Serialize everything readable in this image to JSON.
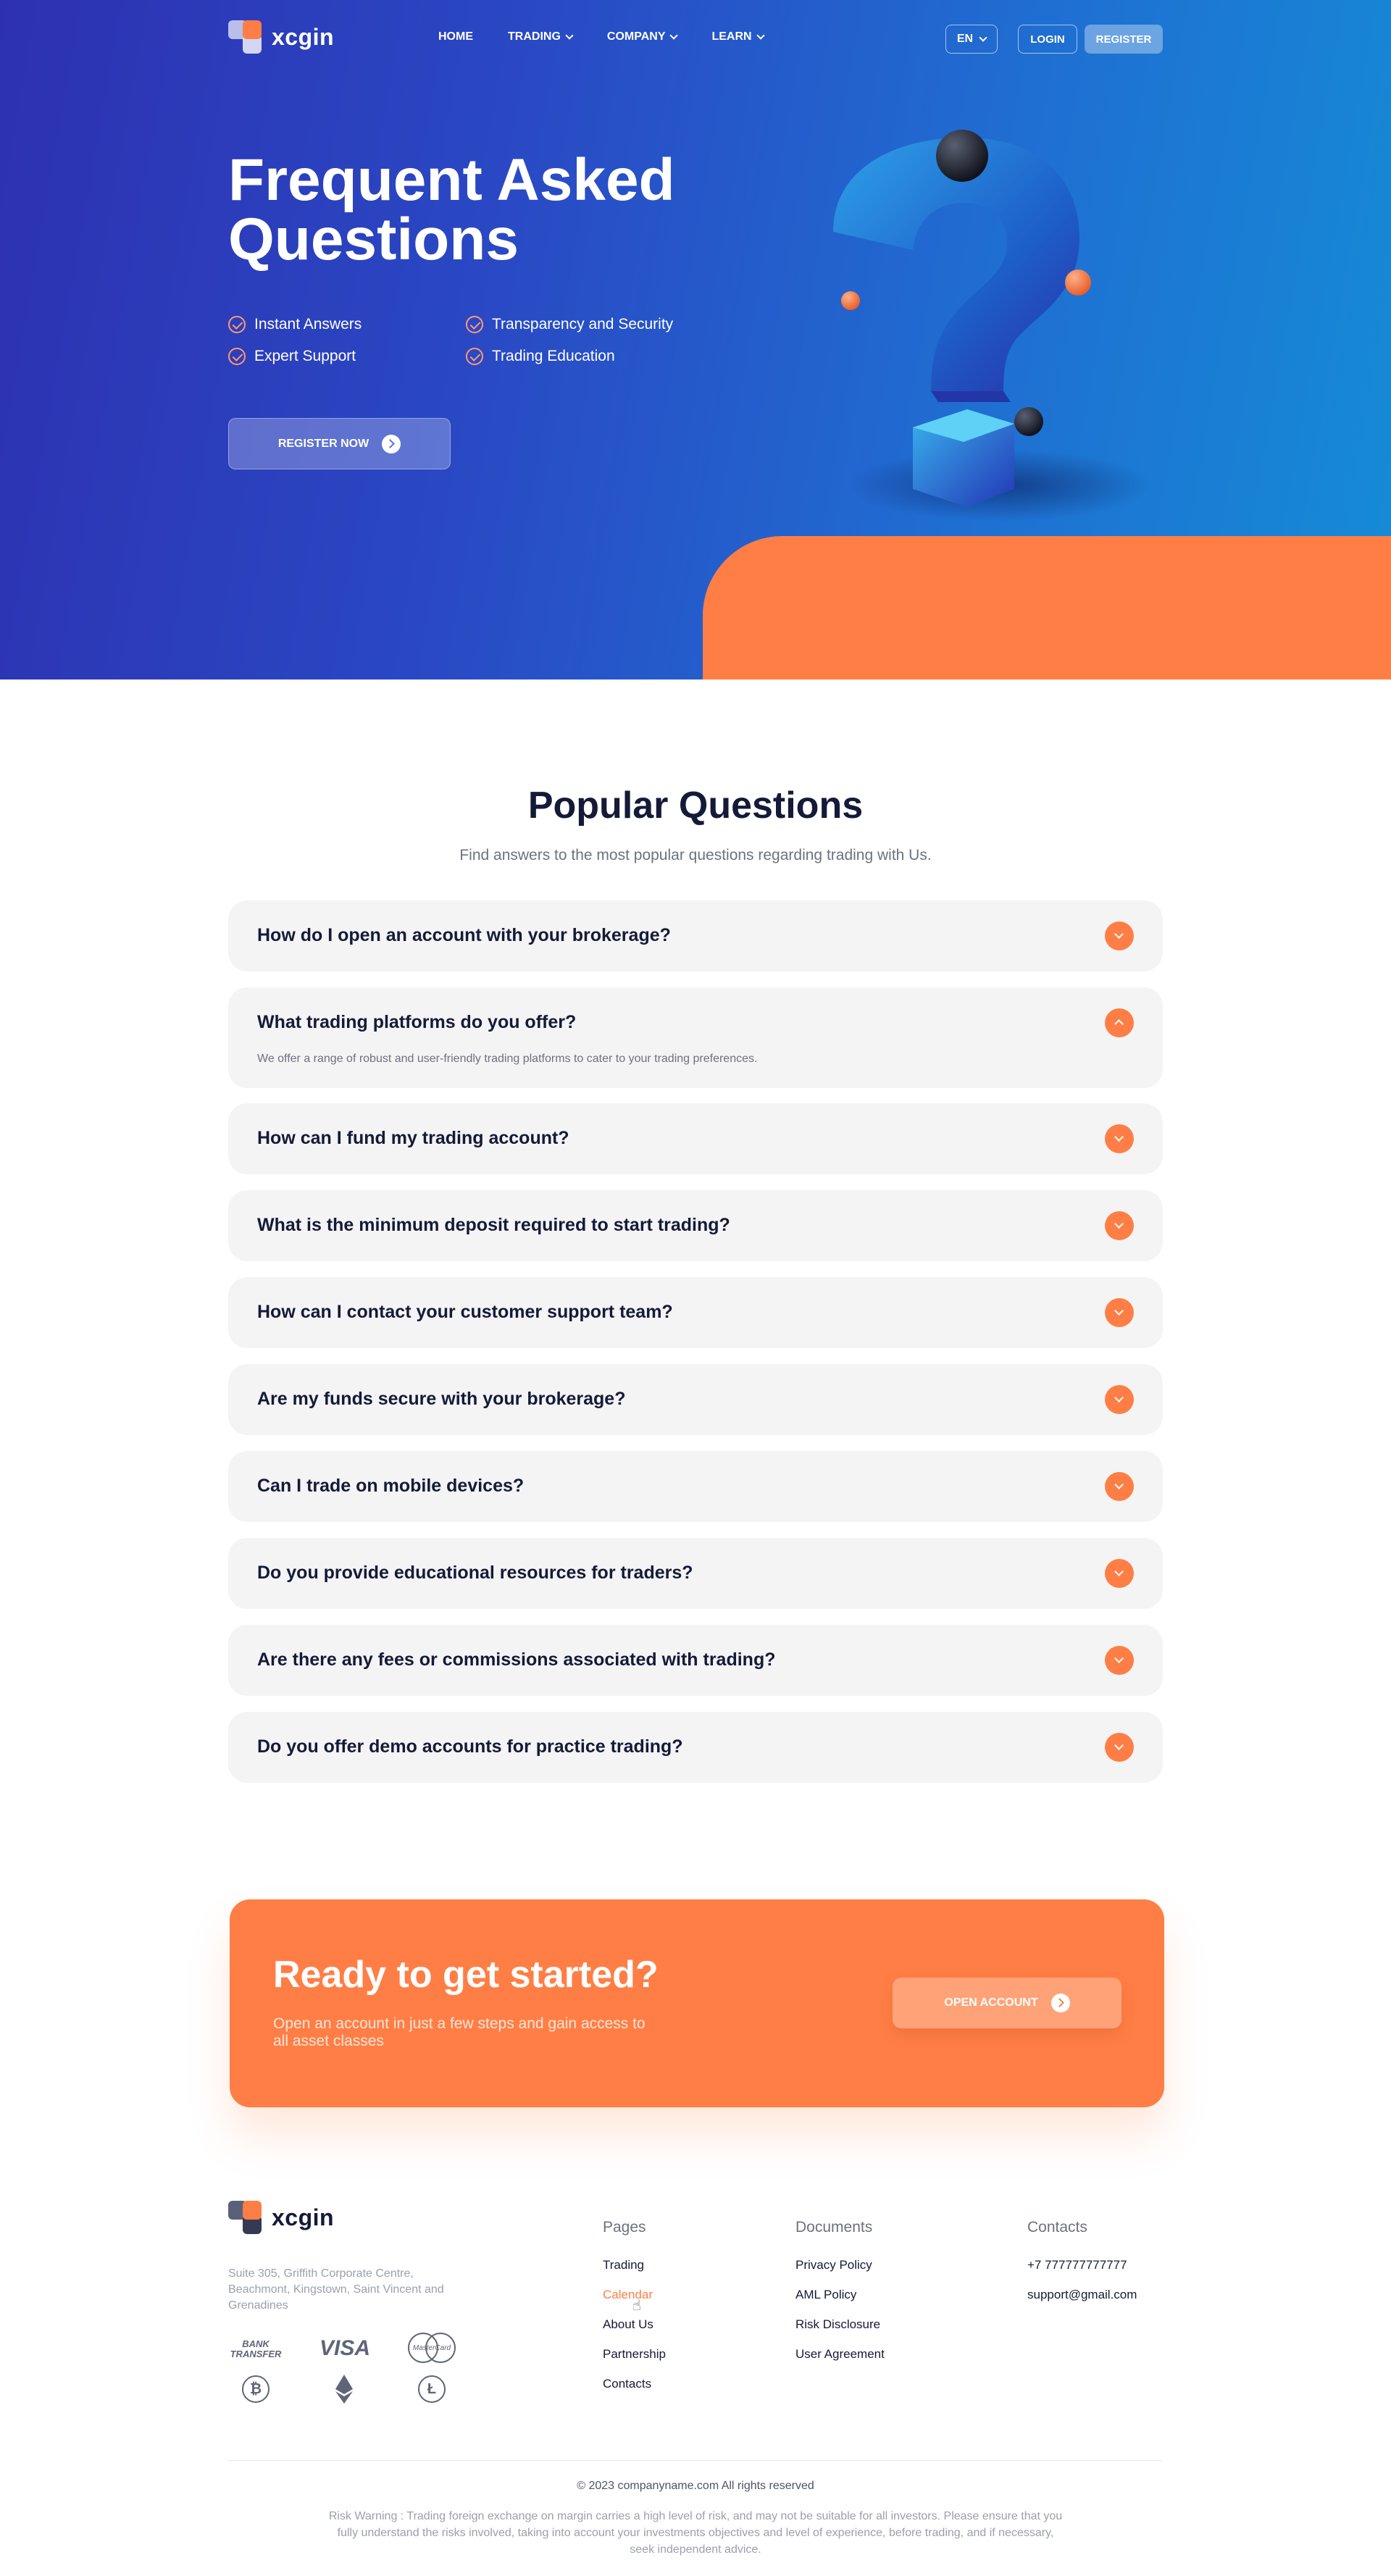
{
  "nav": {
    "logo_text": "xcgin",
    "menu": [
      {
        "label": "HOME",
        "dropdown": false
      },
      {
        "label": "TRADING",
        "dropdown": true
      },
      {
        "label": "COMPANY",
        "dropdown": true
      },
      {
        "label": "LEARN",
        "dropdown": true
      }
    ],
    "language": "EN",
    "login_label": "LOGIN",
    "register_label": "REGISTER"
  },
  "hero": {
    "title_line1": "Frequent Asked",
    "title_line2": "Questions",
    "features": [
      "Instant Answers",
      "Transparency and Security",
      "Expert Support",
      "Trading Education"
    ],
    "cta_label": "REGISTER NOW"
  },
  "faq": {
    "title": "Popular Questions",
    "subtitle": "Find answers to the most popular questions regarding trading with Us.",
    "items": [
      {
        "question": "How do I open an account with your brokerage?",
        "expanded": false,
        "answer": ""
      },
      {
        "question": "What trading platforms do you offer?",
        "expanded": true,
        "answer": "We offer a range of robust and user-friendly trading platforms to cater to your trading preferences."
      },
      {
        "question": "How can I fund my trading account?",
        "expanded": false,
        "answer": ""
      },
      {
        "question": "What is the minimum deposit required to start trading?",
        "expanded": false,
        "answer": ""
      },
      {
        "question": "How can I contact your customer support team?",
        "expanded": false,
        "answer": ""
      },
      {
        "question": "Are my funds secure with your brokerage?",
        "expanded": false,
        "answer": ""
      },
      {
        "question": "Can I trade on mobile devices?",
        "expanded": false,
        "answer": ""
      },
      {
        "question": "Do you provide educational resources for traders?",
        "expanded": false,
        "answer": ""
      },
      {
        "question": "Are there any fees or commissions associated with trading?",
        "expanded": false,
        "answer": ""
      },
      {
        "question": "Do you offer demo accounts for practice trading?",
        "expanded": false,
        "answer": ""
      }
    ]
  },
  "cta": {
    "title": "Ready to get started?",
    "subtitle": "Open an account in just a few steps and gain access to all asset classes",
    "button_label": "OPEN ACCOUNT"
  },
  "footer": {
    "logo_text": "xcgin",
    "address": "Suite 305, Griffith Corporate Centre, Beachmont, Kingstown, Saint Vincent and Grenadines",
    "payments": {
      "bank_line1": "BANK",
      "bank_line2": "TRANSFER",
      "visa": "VISA",
      "mastercard": "MasterCard",
      "bitcoin": "₿",
      "ethereum": "ethereum-icon",
      "litecoin": "Ł"
    },
    "columns": [
      {
        "title": "Pages",
        "links": [
          "Trading",
          "Calendar",
          "About Us",
          "Partnership",
          "Contacts"
        ]
      },
      {
        "title": "Documents",
        "links": [
          "Privacy Policy",
          "AML Policy",
          "Risk Disclosure",
          "User Agreement"
        ]
      },
      {
        "title": "Contacts",
        "links": [
          "+7 777777777777",
          "support@gmail.com"
        ]
      }
    ],
    "active_link": "Calendar",
    "copyright": "© 2023 companyname.com All rights reserved",
    "risk_warning": "Risk Warning : Trading foreign exchange on margin carries a high level of risk, and may not be suitable for all investors. Please ensure that you fully understand the risks involved, taking into account your investments objectives and level of experience, before trading, and if necessary, seek independent advice."
  },
  "colors": {
    "accent": "#ff7e45",
    "hero_start": "#2d31b1",
    "hero_end": "#158cd6",
    "heading": "#151a38"
  }
}
